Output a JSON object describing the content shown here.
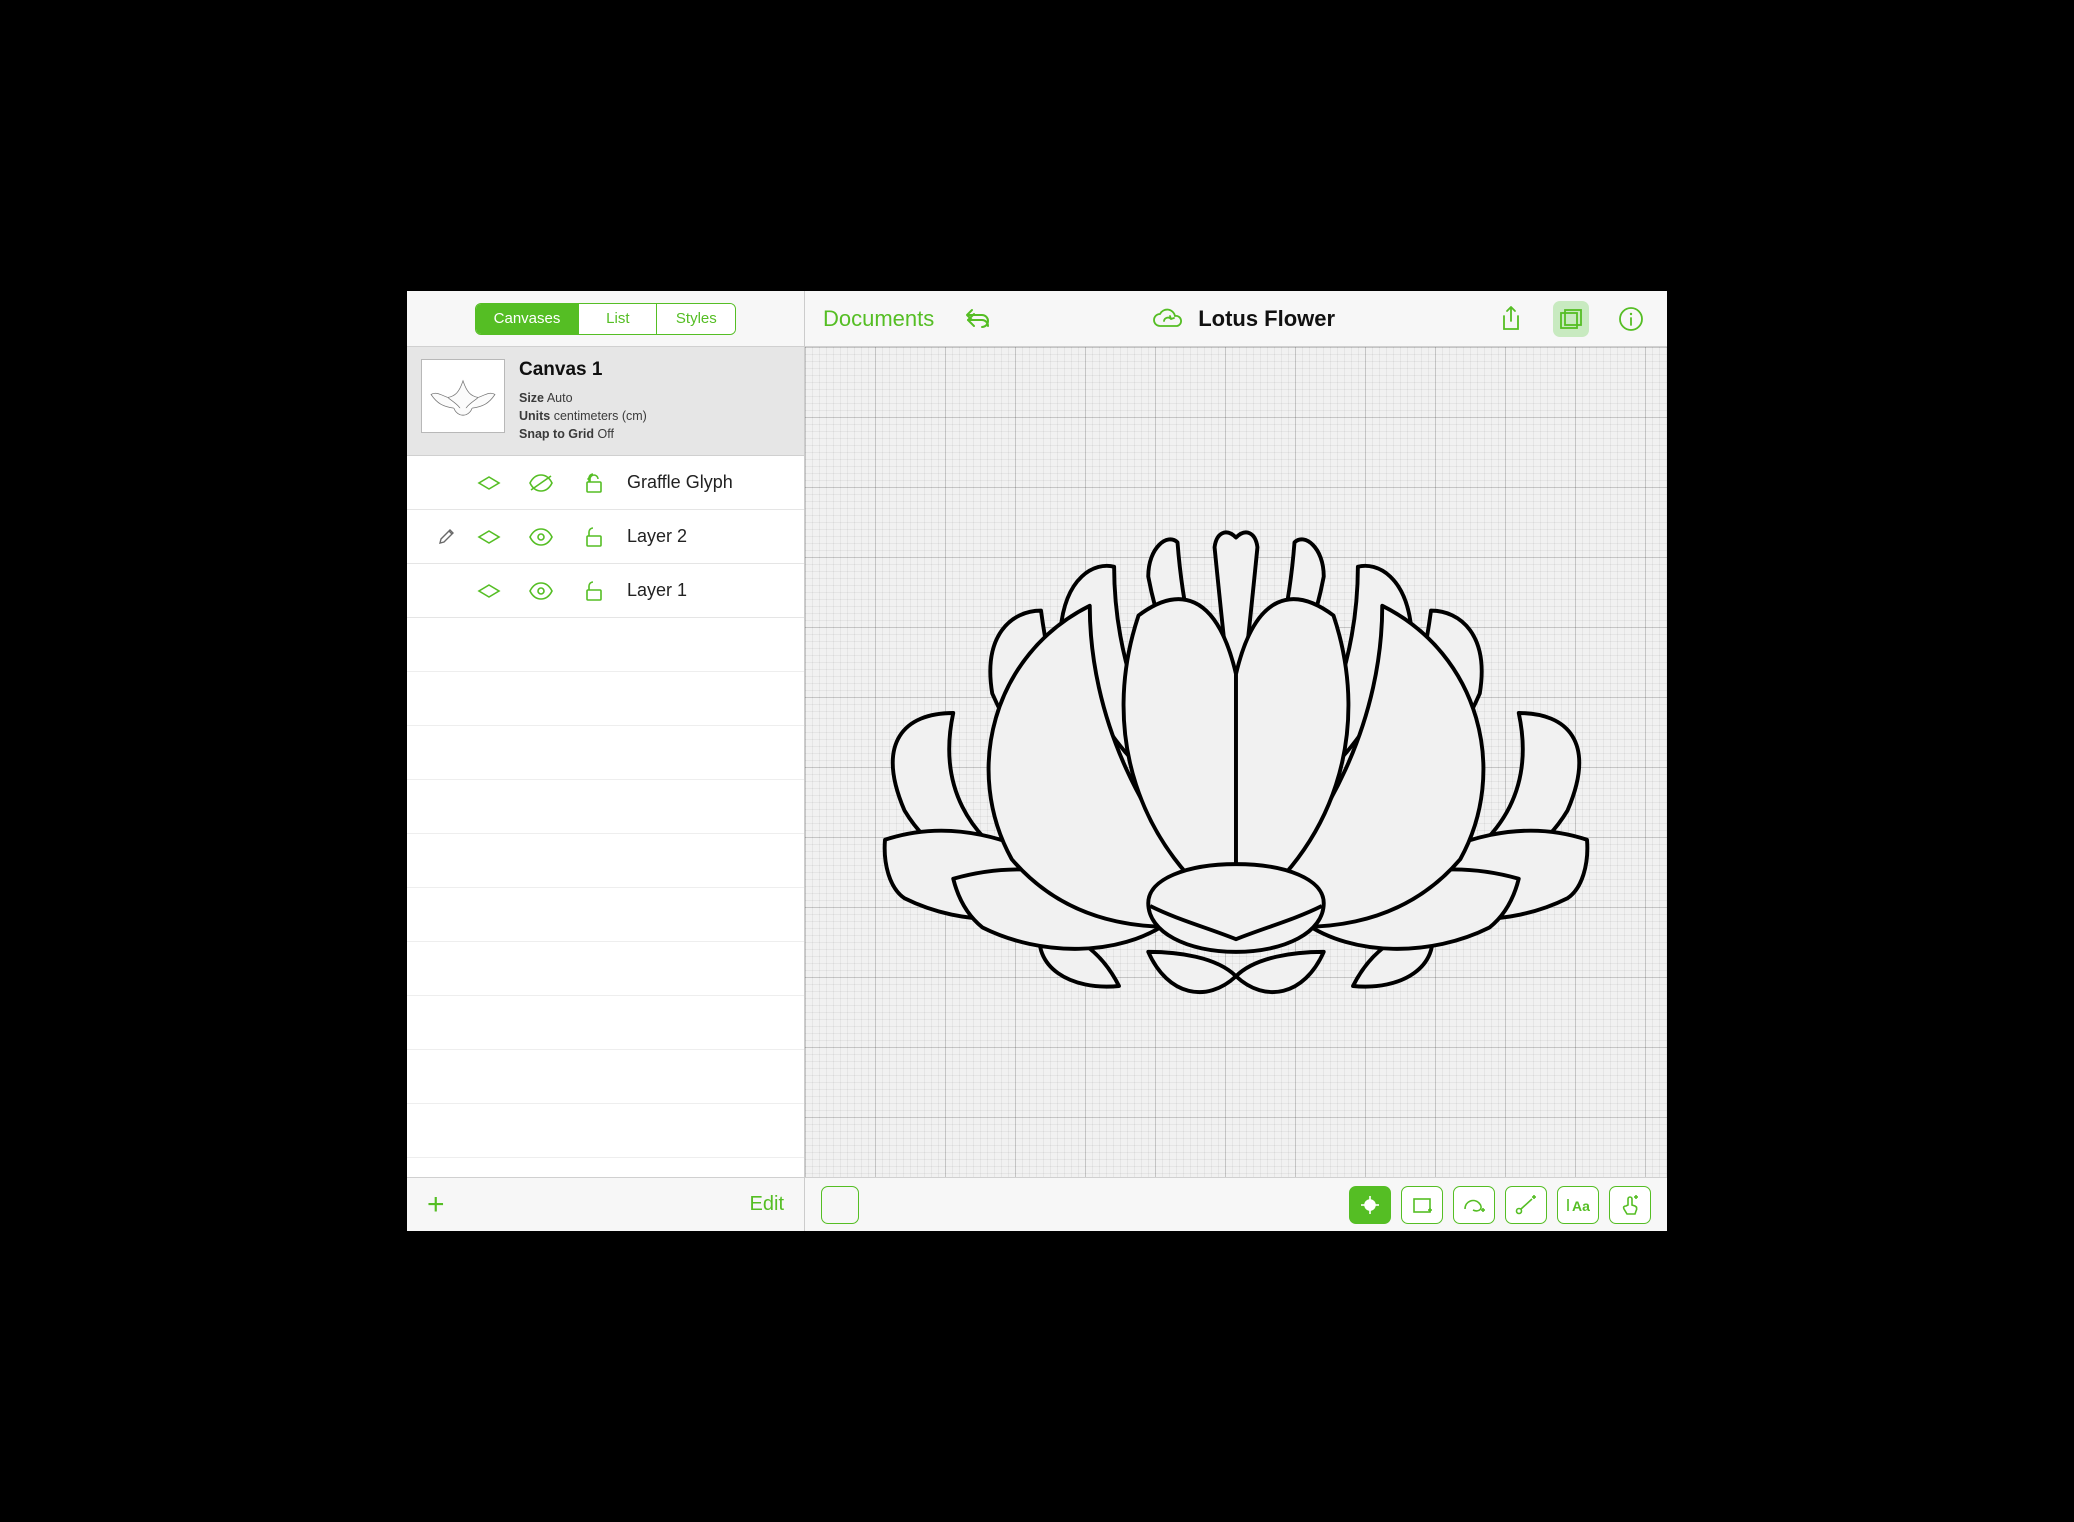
{
  "accent": "#55be24",
  "toolbar": {
    "documents_label": "Documents",
    "title": "Lotus Flower"
  },
  "sidebar": {
    "tabs": [
      "Canvases",
      "List",
      "Styles"
    ],
    "active_tab": 0,
    "canvas": {
      "name": "Canvas 1",
      "size_label": "Size",
      "size_value": "Auto",
      "units_label": "Units",
      "units_value": "centimeters (cm)",
      "snap_label": "Snap to Grid",
      "snap_value": "Off"
    },
    "layers": [
      {
        "name": "Graffle Glyph",
        "editing": false,
        "visible": false,
        "locked": false
      },
      {
        "name": "Layer 2",
        "editing": true,
        "visible": true,
        "locked": false
      },
      {
        "name": "Layer 1",
        "editing": false,
        "visible": true,
        "locked": false
      }
    ],
    "edit_label": "Edit"
  }
}
